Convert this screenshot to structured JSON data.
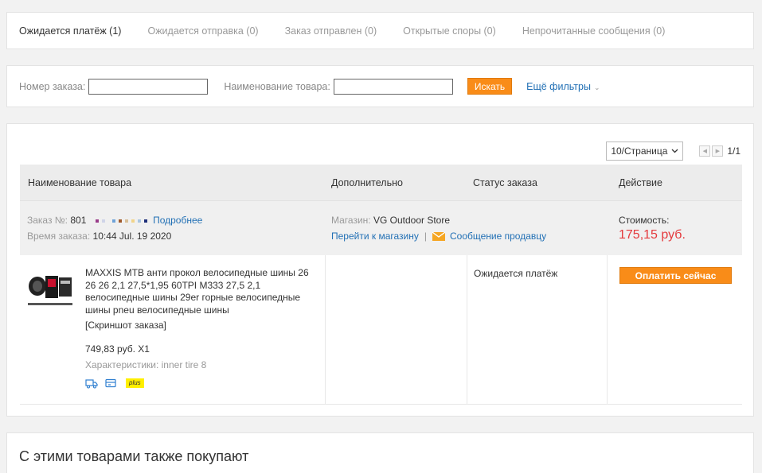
{
  "tabs": [
    {
      "label": "Ожидается платёж (1)",
      "active": true
    },
    {
      "label": "Ожидается отправка (0)",
      "active": false
    },
    {
      "label": "Заказ отправлен (0)",
      "active": false
    },
    {
      "label": "Открытые споры (0)",
      "active": false
    },
    {
      "label": "Непрочитанные сообщения (0)",
      "active": false
    }
  ],
  "filters": {
    "order_number_label": "Номер заказа:",
    "product_name_label": "Наименование товара:",
    "search_button": "Искать",
    "more_filters": "Ещё фильтры"
  },
  "pager": {
    "per_page": "10/Страница",
    "pages": "1/1"
  },
  "table_headers": {
    "product": "Наименование товара",
    "additional": "Дополнительно",
    "status": "Статус заказа",
    "action": "Действие"
  },
  "order": {
    "number_label": "Заказ №:",
    "number_value": "801",
    "details_link": "Подробнее",
    "time_label": "Время заказа:",
    "time_value": "10:44 Jul. 19 2020",
    "store_label": "Магазин:",
    "store_name": "VG Outdoor Store",
    "go_to_store": "Перейти к магазину",
    "separator": "|",
    "message_seller": "Сообщение продавцу",
    "cost_label": "Стоимость:",
    "cost_value": "175,15 руб.",
    "status": "Ожидается платёж",
    "pay_button": "Оплатить сейчас",
    "product": {
      "title": "MAXXIS MTB анти прокол велосипедные шины 26 26 26 2,1 27,5*1,95 60TPI M333 27,5 2,1 велосипедные шины 29er горные велосипедные шины pneu велосипедные шины",
      "snapshot": "[Скриншот заказа]",
      "price_qty": "749,83 руб. X1",
      "characteristics": "Характеристики: inner tire 8",
      "badge": "plus"
    }
  },
  "recommendations_title": "С этими товарами также покупают",
  "colors": {
    "accent_orange": "#f98c18",
    "link_blue": "#2270b5",
    "price_red": "#e4393c",
    "badge_yellow": "#ffef00"
  }
}
